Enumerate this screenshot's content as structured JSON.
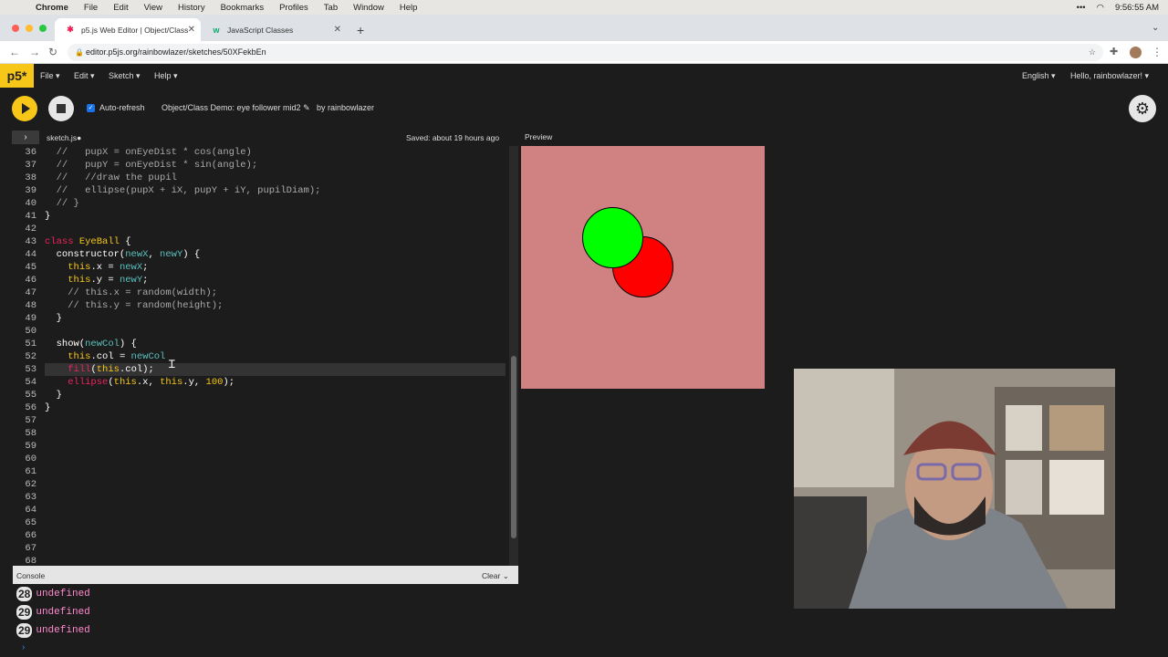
{
  "menubar": {
    "app_name": "Chrome",
    "items": [
      "File",
      "Edit",
      "View",
      "History",
      "Bookmarks",
      "Profiles",
      "Tab",
      "Window",
      "Help"
    ],
    "time": "9:56:55 AM"
  },
  "browser": {
    "tabs": [
      {
        "title": "p5.js Web Editor | Object/Class",
        "icon": "p5-star-icon",
        "active": true
      },
      {
        "title": "JavaScript Classes",
        "icon": "w3schools-icon",
        "active": false
      }
    ],
    "url": "editor.p5js.org/rainbowlazer/sketches/50XFekbEn"
  },
  "p5nav": {
    "logo": "p5*",
    "menus": [
      "File",
      "Edit",
      "Sketch",
      "Help"
    ],
    "language": "English",
    "greeting": "Hello, rainbowlazer!"
  },
  "toolbar": {
    "auto_refresh_label": "Auto-refresh",
    "auto_refresh_checked": true,
    "sketch_name": "Object/Class Demo: eye follower mid2",
    "by_user": "by rainbowlazer"
  },
  "editor": {
    "file_tab": "sketch.js",
    "saved_status": "Saved: about 19 hours ago",
    "line_numbers": [
      "36",
      "37",
      "38",
      "39",
      "40",
      "41",
      "42",
      "43",
      "44",
      "45",
      "46",
      "47",
      "48",
      "49",
      "50",
      "51",
      "52",
      "53",
      "54",
      "55",
      "56",
      "57",
      "58",
      "59",
      "60",
      "61",
      "62",
      "63",
      "64",
      "65",
      "66",
      "67",
      "68"
    ],
    "code_lines": [
      "  //   pupX = onEyeDist * cos(angle)",
      "  //   pupY = onEyeDist * sin(angle);",
      "  //   //draw the pupil",
      "  //   ellipse(pupX + iX, pupY + iY, pupilDiam);",
      "  // }",
      "}",
      "",
      "class EyeBall {",
      "  constructor(newX, newY) {",
      "    this.x = newX;",
      "    this.y = newY;",
      "    // this.x = random(width);",
      "    // this.y = random(height);",
      "  }",
      "",
      "  show(newCol) {",
      "    this.col = newCol",
      "    fill(this.col);",
      "    ellipse(this.x, this.y, 100);",
      "  }",
      "}"
    ]
  },
  "preview": {
    "label": "Preview",
    "background_color": "#d08181",
    "eyes": [
      {
        "color": "#00ff00",
        "label": "green-eye"
      },
      {
        "color": "#ff0000",
        "label": "red-eye"
      }
    ]
  },
  "console": {
    "title": "Console",
    "clear_label": "Clear",
    "entries": [
      {
        "count": "28",
        "value": "undefined"
      },
      {
        "count": "29",
        "value": "undefined"
      },
      {
        "count": "29",
        "value": "undefined"
      }
    ]
  }
}
